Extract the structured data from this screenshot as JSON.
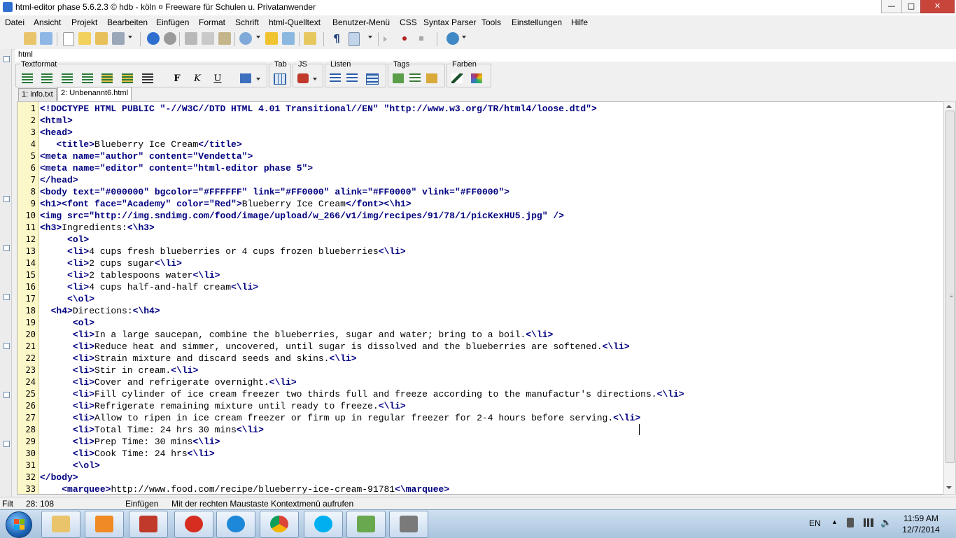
{
  "window": {
    "title": "html-editor phase 5.6.2.3  ©  hdb - köln  ¤  Freeware für Schulen u. Privatanwender",
    "controls": {
      "minimize": "—",
      "maximize": "□",
      "close": "✕"
    }
  },
  "menu": [
    "Datei",
    "Ansicht",
    "Projekt",
    "Bearbeiten",
    "Einfügen",
    "Format",
    "Schrift",
    "html-Quelltext",
    "Benutzer-Menü",
    "CSS",
    "Syntax Parser",
    "Tools",
    "Einstellungen",
    "Hilfe"
  ],
  "path": "html",
  "format_groups": {
    "textformat": {
      "label": "Textformat",
      "bold": "F",
      "italic": "K",
      "underline": "U"
    },
    "tab": {
      "label": "Tab"
    },
    "js": {
      "label": "JS"
    },
    "listen": {
      "label": "Listen"
    },
    "tags": {
      "label": "Tags"
    },
    "farben": {
      "label": "Farben"
    }
  },
  "tabs": [
    {
      "label": "1: info.txt",
      "active": false
    },
    {
      "label": "2: Unbenannt6.html",
      "active": true
    }
  ],
  "editor": {
    "lines": [
      "<!DOCTYPE HTML PUBLIC \"-//W3C//DTD HTML 4.01 Transitional//EN\" \"http://www.w3.org/TR/html4/loose.dtd\">",
      "<html>",
      "<head>",
      "   <title>Blueberry Ice Cream</title>",
      "<meta name=\"author\" content=\"Vendetta\">",
      "<meta name=\"editor\" content=\"html-editor phase 5\">",
      "</head>",
      "<body text=\"#000000\" bgcolor=\"#FFFFFF\" link=\"#FF0000\" alink=\"#FF0000\" vlink=\"#FF0000\">",
      "<h1><font face=\"Academy\" color=\"Red\">Blueberry Ice Cream</font><\\h1>",
      "<img src=\"http://img.sndimg.com/food/image/upload/w_266/v1/img/recipes/91/78/1/picKexHU5.jpg\" />",
      "<h3>Ingredients:<\\h3>",
      "     <ol>",
      "     <li>4 cups fresh blueberries or 4 cups frozen blueberries<\\li>",
      "     <li>2 cups sugar<\\li>",
      "     <li>2 tablespoons water<\\li>",
      "     <li>4 cups half-and-half cream<\\li>",
      "     <\\ol>",
      "  <h4>Directions:<\\h4>",
      "      <ol>",
      "      <li>In a large saucepan, combine the blueberries, sugar and water; bring to a boil.<\\li>",
      "      <li>Reduce heat and simmer, uncovered, until sugar is dissolved and the blueberries are softened.<\\li>",
      "      <li>Strain mixture and discard seeds and skins.<\\li>",
      "      <li>Stir in cream.<\\li>",
      "      <li>Cover and refrigerate overnight.<\\li>",
      "      <li>Fill cylinder of ice cream freezer two thirds full and freeze according to the manufactur's directions.<\\li>",
      "      <li>Refrigerate remaining mixture until ready to freeze.<\\li>",
      "      <li>Allow to ripen in ice cream freezer or firm up in regular freezer for 2-4 hours before serving.<\\li>",
      "      <li>Total Time: 24 hrs 30 mins<\\li>",
      "      <li>Prep Time: 30 mins<\\li>",
      "      <li>Cook Time: 24 hrs<\\li>",
      "      <\\ol>",
      "</body>",
      "    <marquee>http://www.food.com/recipe/blueberry-ice-cream-91781<\\marquee>"
    ]
  },
  "status": {
    "mode": "Filt",
    "position": "28: 108",
    "insert": "Einfügen",
    "hint": "Mit der rechten Maustaste Kontextmenü aufrufen"
  },
  "taskbar": {
    "apps": [
      "file-explorer",
      "media-player",
      "pdf-reader",
      "pin-app",
      "internet-explorer",
      "chrome",
      "skype",
      "chart-editor",
      "html-editor"
    ],
    "language": "EN",
    "time": "11:59 AM",
    "date": "12/7/2014"
  },
  "colors": {
    "tag": "#000080",
    "gutter": "#fbf7c9",
    "close": "#c7453a"
  }
}
